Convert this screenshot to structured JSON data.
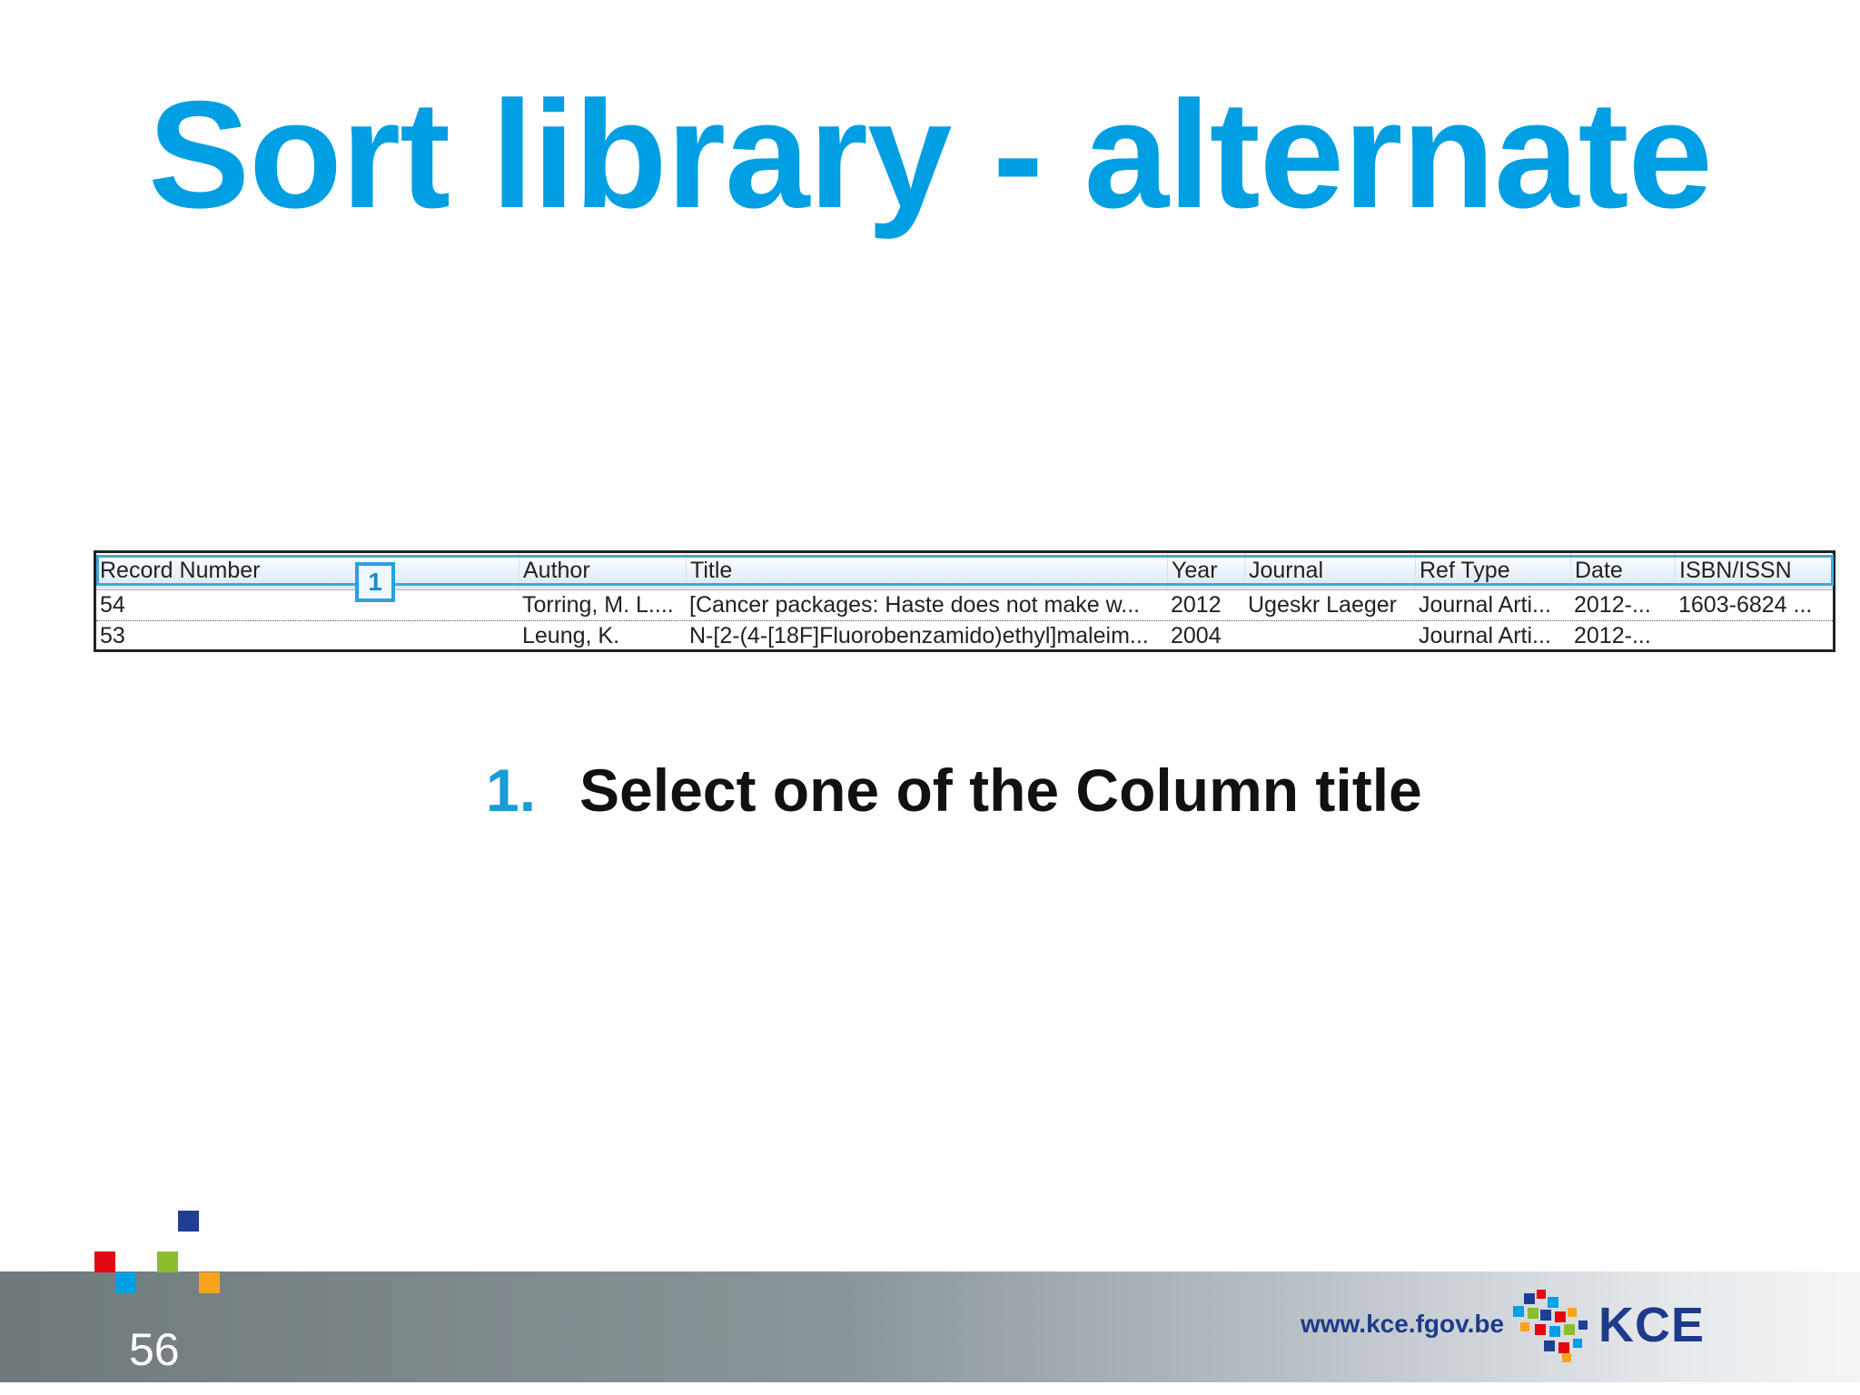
{
  "slide": {
    "title": "Sort library - alternate",
    "page_number": "56"
  },
  "table": {
    "callout_label": "1",
    "columns": [
      "Record Number",
      "Author",
      "Title",
      "Year",
      "Journal",
      "Ref Type",
      "Date",
      "ISBN/ISSN"
    ],
    "rows": [
      [
        "54",
        "Torring, M. L....",
        "[Cancer packages: Haste does not make w...",
        "2012",
        "Ugeskr Laeger",
        "Journal Arti...",
        "2012-...",
        "1603-6824 ..."
      ],
      [
        "53",
        "Leung, K.",
        "N-[2-(4-[18F]Fluorobenzamido)ethyl]maleim...",
        "2004",
        "",
        "Journal Arti...",
        "2012-...",
        ""
      ]
    ]
  },
  "instruction": {
    "number": "1.",
    "text": "Select one of the Column title"
  },
  "footer": {
    "url": "www.kce.fgov.be",
    "brand": "KCE"
  },
  "colors": {
    "title_blue": "#009fe3",
    "brand_navy": "#1e3a8a",
    "logo_red": "#e30613",
    "logo_green": "#8cbd2e",
    "logo_orange": "#f7a41c",
    "logo_cyan": "#00a0e3"
  }
}
